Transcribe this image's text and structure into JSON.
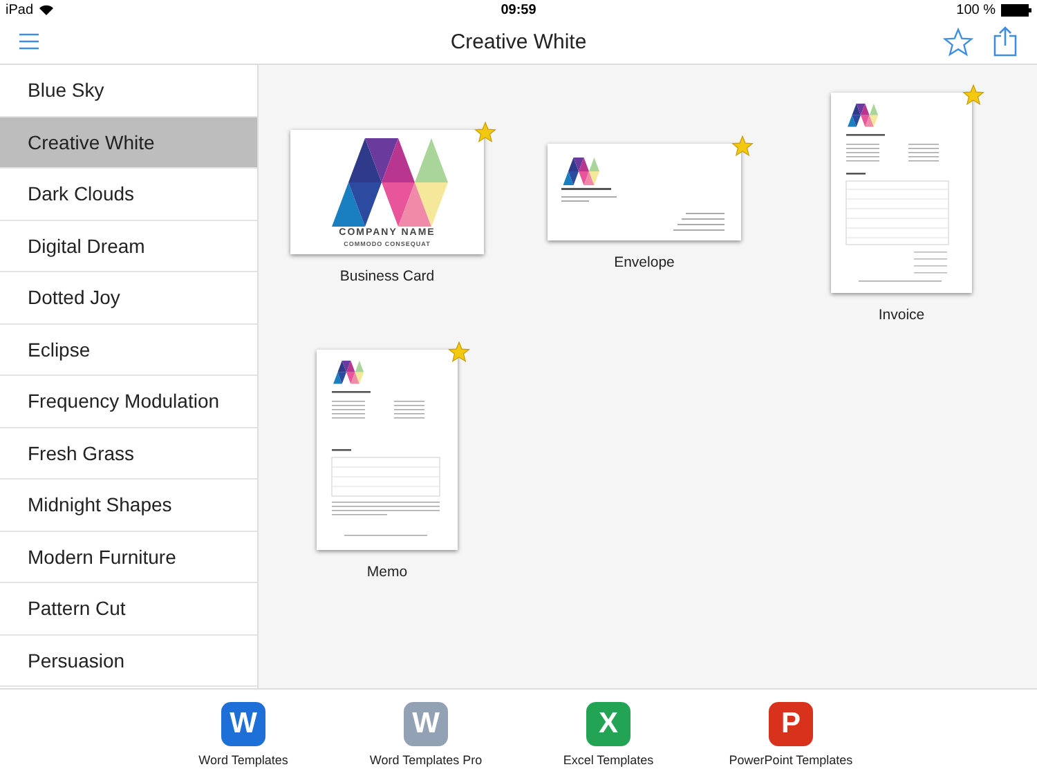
{
  "status_bar": {
    "device": "iPad",
    "time": "09:59",
    "battery": "100 %"
  },
  "nav_bar": {
    "title": "Creative White"
  },
  "sidebar": {
    "items": [
      {
        "label": "Blue Sky",
        "selected": false
      },
      {
        "label": "Creative White",
        "selected": true
      },
      {
        "label": "Dark Clouds",
        "selected": false
      },
      {
        "label": "Digital Dream",
        "selected": false
      },
      {
        "label": "Dotted Joy",
        "selected": false
      },
      {
        "label": "Eclipse",
        "selected": false
      },
      {
        "label": "Frequency Modulation",
        "selected": false
      },
      {
        "label": "Fresh Grass",
        "selected": false
      },
      {
        "label": "Midnight Shapes",
        "selected": false
      },
      {
        "label": "Modern Furniture",
        "selected": false
      },
      {
        "label": "Pattern Cut",
        "selected": false
      },
      {
        "label": "Persuasion",
        "selected": false
      }
    ]
  },
  "templates": [
    {
      "kind": "card",
      "label": "Business Card",
      "starred": true,
      "company": "COMPANY NAME",
      "tagline": "COMMODO CONSEQUAT"
    },
    {
      "kind": "envelope",
      "label": "Envelope",
      "starred": true
    },
    {
      "kind": "invoice",
      "label": "Invoice",
      "starred": true
    },
    {
      "kind": "memo",
      "label": "Memo",
      "starred": true
    }
  ],
  "tab_bar": [
    {
      "letter": "W",
      "label": "Word Templates",
      "color": "#1f6fd8"
    },
    {
      "letter": "W",
      "label": "Word Templates Pro",
      "color": "#93a1b5"
    },
    {
      "letter": "X",
      "label": "Excel Templates",
      "color": "#23a455"
    },
    {
      "letter": "P",
      "label": "PowerPoint Templates",
      "color": "#d9321c"
    }
  ]
}
